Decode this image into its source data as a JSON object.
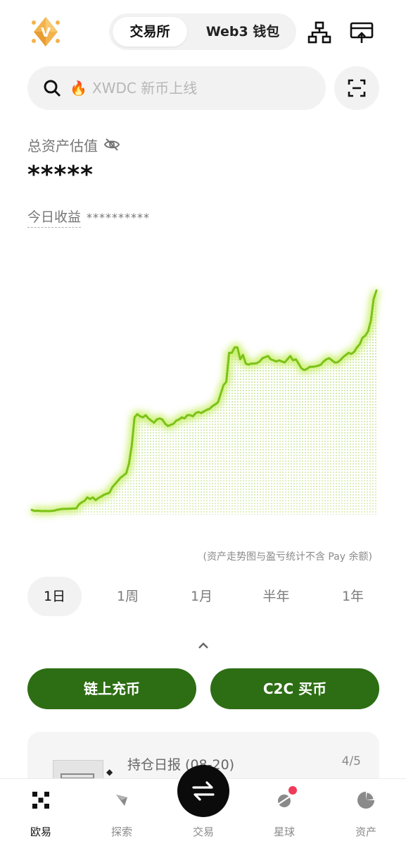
{
  "header": {
    "logo_icon": "vip-diamond-logo",
    "tabs": [
      {
        "label": "交易所",
        "active": true
      },
      {
        "label": "Web3 钱包",
        "active": false
      }
    ],
    "icons": [
      "network-icon",
      "card-withdraw-icon"
    ]
  },
  "search": {
    "placeholder": "XWDC 新币上线",
    "hot_icon": "🔥"
  },
  "assets": {
    "label": "总资产估值",
    "value": "*****",
    "pnl_label": "今日收益",
    "pnl_value": "**********"
  },
  "chart_data": {
    "type": "area",
    "title": "",
    "xlabel": "",
    "ylabel": "",
    "grid": false,
    "color": "#7cc219",
    "y": [
      2,
      1.5,
      1.6,
      1.5,
      1.4,
      1.5,
      1.4,
      1.5,
      1.6,
      2,
      2.2,
      2.4,
      2.4,
      2.5,
      2.5,
      2.6,
      2.6,
      4.5,
      5.5,
      6.2,
      7.8,
      7,
      7.8,
      6.5,
      7.5,
      8.2,
      9,
      9.5,
      10,
      12.5,
      14,
      15.5,
      17,
      18,
      19,
      23.5,
      32,
      45,
      46.5,
      45.5,
      45,
      46,
      44.5,
      43.5,
      42.5,
      44,
      44.5,
      44,
      42,
      41,
      41.5,
      42,
      43.5,
      44,
      45,
      44.5,
      46,
      46,
      45.5,
      47,
      47.5,
      47,
      47.8,
      48.5,
      49,
      50.2,
      51,
      52,
      56,
      60,
      61.5,
      75,
      75,
      77.5,
      77.5,
      72,
      74,
      70,
      69.5,
      70,
      70,
      70.2,
      71,
      72.5,
      73,
      73.5,
      72,
      71.5,
      71,
      71.5,
      71,
      70.5,
      72,
      73.5,
      71.5,
      72,
      70,
      67.8,
      67,
      67.5,
      68.5,
      68.5,
      68.7,
      69,
      69.5,
      71,
      72,
      72.5,
      71.5,
      70.5,
      70.6,
      71.6,
      73,
      74,
      75,
      74.5,
      75.5,
      77.5,
      79,
      82,
      83,
      85,
      90,
      100,
      104
    ]
  },
  "chart_note": "(资产走势图与盈亏统计不含 Pay 余额)",
  "periods": [
    {
      "label": "1日",
      "active": true
    },
    {
      "label": "1周",
      "active": false
    },
    {
      "label": "1月",
      "active": false
    },
    {
      "label": "半年",
      "active": false
    },
    {
      "label": "1年",
      "active": false
    }
  ],
  "actions": {
    "deposit": "链上充币",
    "buy": "C2C 买币"
  },
  "report": {
    "title": "持仓日报 (08-20)",
    "page": "4/5"
  },
  "nav": [
    {
      "label": "欧易",
      "icon": "okx-logo-icon",
      "active": true
    },
    {
      "label": "探索",
      "icon": "compass-icon",
      "active": false
    },
    {
      "label": "交易",
      "icon": "swap-arrows-icon",
      "active": false
    },
    {
      "label": "星球",
      "icon": "planet-icon",
      "active": false
    },
    {
      "label": "资产",
      "icon": "pie-chart-icon",
      "active": false
    }
  ]
}
